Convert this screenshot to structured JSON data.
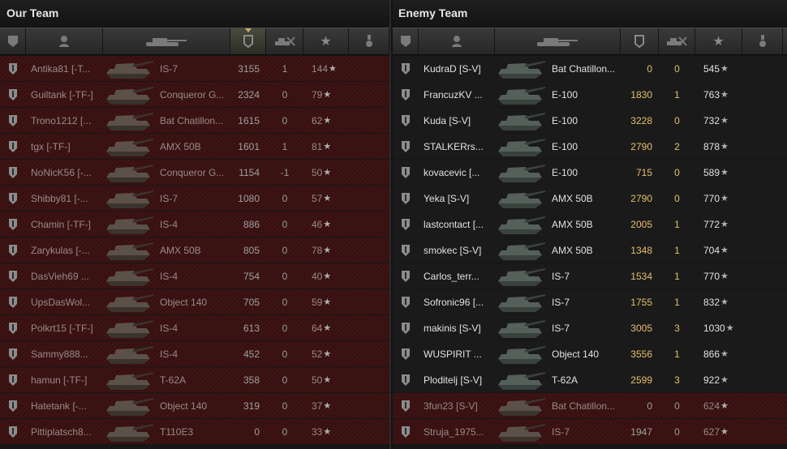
{
  "left_team": {
    "title": "Our Team",
    "rows": [
      {
        "player": "Antika81 [-T...",
        "tank": "IS-7",
        "damage": "3155",
        "kills": "1",
        "xp": "144"
      },
      {
        "player": "Guiltank [-TF-]",
        "tank": "Conqueror G...",
        "damage": "2324",
        "kills": "0",
        "xp": "79"
      },
      {
        "player": "Trono1212 [...",
        "tank": "Bat Chatillon...",
        "damage": "1615",
        "kills": "0",
        "xp": "62"
      },
      {
        "player": "tgx [-TF-]",
        "tank": "AMX 50B",
        "damage": "1601",
        "kills": "1",
        "xp": "81"
      },
      {
        "player": "NoNicK56 [-...",
        "tank": "Conqueror G...",
        "damage": "1154",
        "kills": "-1",
        "xp": "50"
      },
      {
        "player": "Shibby81 [-...",
        "tank": "IS-7",
        "damage": "1080",
        "kills": "0",
        "xp": "57"
      },
      {
        "player": "Chamin [-TF-]",
        "tank": "IS-4",
        "damage": "886",
        "kills": "0",
        "xp": "46"
      },
      {
        "player": "Zarykulas [-...",
        "tank": "AMX 50B",
        "damage": "805",
        "kills": "0",
        "xp": "78"
      },
      {
        "player": "DasVieh69 ...",
        "tank": "IS-4",
        "damage": "754",
        "kills": "0",
        "xp": "40"
      },
      {
        "player": "UpsDasWol...",
        "tank": "Object 140",
        "damage": "705",
        "kills": "0",
        "xp": "59"
      },
      {
        "player": "Polkrt15 [-TF-]",
        "tank": "IS-4",
        "damage": "613",
        "kills": "0",
        "xp": "64"
      },
      {
        "player": "Sammy888...",
        "tank": "IS-4",
        "damage": "452",
        "kills": "0",
        "xp": "52"
      },
      {
        "player": "hamun [-TF-]",
        "tank": "T-62A",
        "damage": "358",
        "kills": "0",
        "xp": "50"
      },
      {
        "player": "Hatetank [-...",
        "tank": "Object 140",
        "damage": "319",
        "kills": "0",
        "xp": "37"
      },
      {
        "player": "Pittiplatsch8...",
        "tank": "T110E3",
        "damage": "0",
        "kills": "0",
        "xp": "33"
      }
    ]
  },
  "right_team": {
    "title": "Enemy Team",
    "rows": [
      {
        "player": "KudraD [S-V]",
        "tank": "Bat Chatillon...",
        "damage": "0",
        "kills": "0",
        "xp": "545",
        "state": "alive"
      },
      {
        "player": "FrancuzKV ...",
        "tank": "E-100",
        "damage": "1830",
        "kills": "1",
        "xp": "763",
        "state": "alive"
      },
      {
        "player": "Kuda [S-V]",
        "tank": "E-100",
        "damage": "3228",
        "kills": "0",
        "xp": "732",
        "state": "alive"
      },
      {
        "player": "STALKERrs...",
        "tank": "E-100",
        "damage": "2790",
        "kills": "2",
        "xp": "878",
        "state": "alive"
      },
      {
        "player": "kovacevic [...",
        "tank": "E-100",
        "damage": "715",
        "kills": "0",
        "xp": "589",
        "state": "alive"
      },
      {
        "player": "Yeka [S-V]",
        "tank": "AMX 50B",
        "damage": "2790",
        "kills": "0",
        "xp": "770",
        "state": "alive"
      },
      {
        "player": "lastcontact [...",
        "tank": "AMX 50B",
        "damage": "2005",
        "kills": "1",
        "xp": "772",
        "state": "alive"
      },
      {
        "player": "smokec [S-V]",
        "tank": "AMX 50B",
        "damage": "1348",
        "kills": "1",
        "xp": "704",
        "state": "alive"
      },
      {
        "player": "Carlos_terr...",
        "tank": "IS-7",
        "damage": "1534",
        "kills": "1",
        "xp": "770",
        "state": "alive"
      },
      {
        "player": "Sofronic96 [...",
        "tank": "IS-7",
        "damage": "1755",
        "kills": "1",
        "xp": "832",
        "state": "alive"
      },
      {
        "player": "makinis [S-V]",
        "tank": "IS-7",
        "damage": "3005",
        "kills": "3",
        "xp": "1030",
        "state": "alive"
      },
      {
        "player": "WUSPIRIT ...",
        "tank": "Object 140",
        "damage": "3556",
        "kills": "1",
        "xp": "866",
        "state": "alive"
      },
      {
        "player": "Ploditelj [S-V]",
        "tank": "T-62A",
        "damage": "2599",
        "kills": "3",
        "xp": "922",
        "state": "alive"
      },
      {
        "player": "3fun23 [S-V]",
        "tank": "Bat Chatillon...",
        "damage": "0",
        "kills": "0",
        "xp": "624",
        "state": "dead"
      },
      {
        "player": "Struja_1975...",
        "tank": "IS-7",
        "damage": "1947",
        "kills": "0",
        "xp": "627",
        "state": "dead"
      }
    ]
  },
  "header_icons": [
    "platoon-icon",
    "player-icon",
    "tank-icon",
    "damage-icon",
    "kills-icon",
    "xp-star-icon",
    "medal-icon"
  ],
  "colors": {
    "dead_row": "#3e1414",
    "alive_row": "#1a1a1a",
    "highlight_value": "#e4c06a"
  },
  "star_glyph": "★"
}
